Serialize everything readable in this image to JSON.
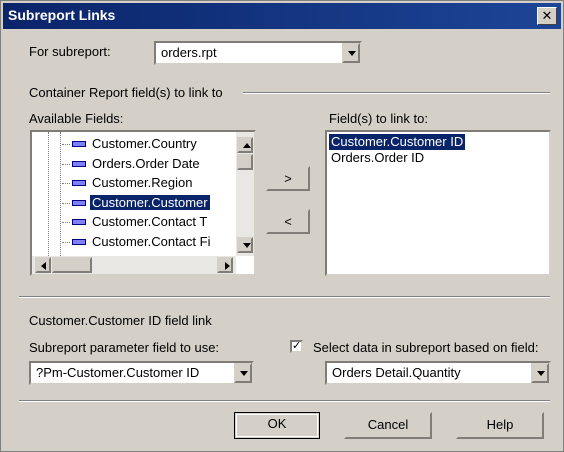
{
  "window": {
    "title": "Subreport Links",
    "close_glyph": "✕"
  },
  "subreport": {
    "label": "For subreport:",
    "value": "orders.rpt"
  },
  "container_group_label": "Container Report field(s) to link to",
  "available_fields": {
    "label": "Available Fields:",
    "items": [
      {
        "label": "Customer.Country",
        "selected": false
      },
      {
        "label": "Orders.Order Date",
        "selected": false
      },
      {
        "label": "Customer.Region",
        "selected": false
      },
      {
        "label": "Customer.Customer",
        "selected": true
      },
      {
        "label": "Customer.Contact T",
        "selected": false
      },
      {
        "label": "Customer.Contact Fi",
        "selected": false
      }
    ]
  },
  "buttons": {
    "add": ">",
    "remove": "<",
    "ok": "OK",
    "cancel": "Cancel",
    "help": "Help"
  },
  "link_fields": {
    "label": "Field(s) to link to:",
    "items": [
      {
        "label": "Customer.Customer ID",
        "selected": true
      },
      {
        "label": "Orders.Order ID",
        "selected": false
      }
    ]
  },
  "field_link": {
    "heading": "Customer.Customer ID field link",
    "param_label": "Subreport parameter field to use:",
    "param_value": "?Pm-Customer.Customer ID",
    "select_checkbox_label": "Select data in subreport based on field:",
    "select_checked": true,
    "check_glyph": "✓",
    "select_value": "Orders Detail.Quantity"
  }
}
